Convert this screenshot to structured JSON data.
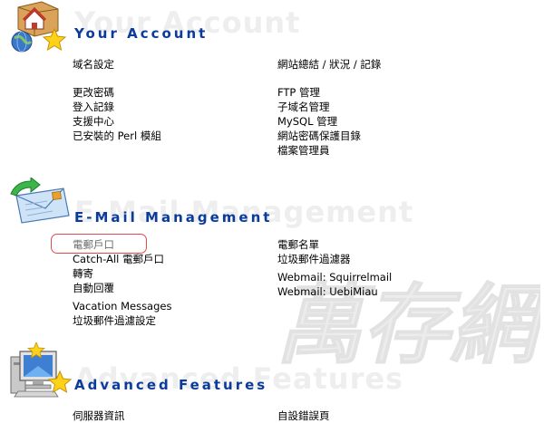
{
  "watermark": {
    "text": "萬存網"
  },
  "sections": {
    "account": {
      "title": "Your Account",
      "ghost": "Your Account",
      "left": [
        "域名設定",
        "更改密碼",
        "登入記錄",
        "支援中心",
        "已安裝的 Perl 模組"
      ],
      "right": [
        "網站總結 / 狀況 / 記錄",
        "FTP 管理",
        "子域名管理",
        "MySQL 管理",
        "網站密碼保護目錄",
        "檔案管理員"
      ]
    },
    "email": {
      "title": "E-Mail Management",
      "ghost": "E-Mail Management",
      "left": [
        "電郵戶口",
        "Catch-All 電郵戶口",
        "轉寄",
        "自動回覆",
        "Vacation Messages",
        "垃圾郵件過濾設定"
      ],
      "right": [
        "電郵名單",
        "垃圾郵件過濾器",
        "Webmail: Squirrelmail",
        "Webmail: UebiMiau"
      ]
    },
    "advanced": {
      "title": "Advanced Features",
      "ghost": "Advanced Features",
      "left": [
        "伺服器資訊"
      ],
      "right": [
        "自設錯誤頁"
      ]
    }
  },
  "colors": {
    "title": "#0b3c9c",
    "highlight_border": "#e24a4a",
    "ghost": "#eeeeee"
  },
  "icons": [
    "house-globe-star-icon",
    "email-envelope-icon",
    "computer-monitor-star-icon"
  ]
}
